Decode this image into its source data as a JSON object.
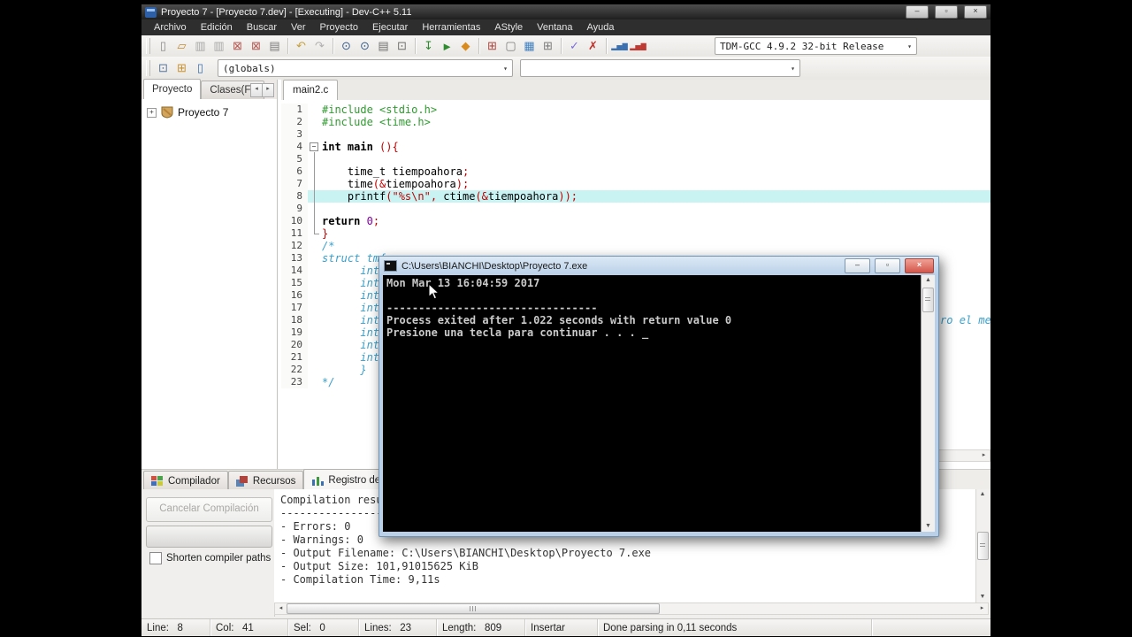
{
  "window": {
    "title": "Proyecto 7 - [Proyecto 7.dev] - [Executing] - Dev-C++ 5.11",
    "buttons": {
      "minimize": "–",
      "restore": "▫",
      "close": "×"
    }
  },
  "menus": [
    "Archivo",
    "Edición",
    "Buscar",
    "Ver",
    "Proyecto",
    "Ejecutar",
    "Herramientas",
    "AStyle",
    "Ventana",
    "Ayuda"
  ],
  "toolbar": {
    "compiler_value": "TDM-GCC 4.9.2 32-bit Release",
    "globals_value": "(globals)",
    "row1": [
      {
        "name": "new-source-icon",
        "g": "▯",
        "c": "#8a8a8a"
      },
      {
        "name": "open-file-icon",
        "g": "▱",
        "c": "#c08a2e"
      },
      {
        "name": "save-icon",
        "g": "▥",
        "c": "#a8a8a8"
      },
      {
        "name": "save-all-icon",
        "g": "▥",
        "c": "#a8a8a8"
      },
      {
        "name": "close-file-icon",
        "g": "⊠",
        "c": "#b5564e"
      },
      {
        "name": "close-all-icon",
        "g": "⊠",
        "c": "#b5564e"
      },
      {
        "name": "print-icon",
        "g": "▤",
        "c": "#7a7a7a"
      },
      {
        "sep": true
      },
      {
        "name": "undo-icon",
        "g": "↶",
        "c": "#c5a13f"
      },
      {
        "name": "redo-icon",
        "g": "↷",
        "c": "#b0b0b0"
      },
      {
        "sep": true
      },
      {
        "name": "find-icon",
        "g": "⊙",
        "c": "#3a5d8c"
      },
      {
        "name": "find-replace-icon",
        "g": "⊙",
        "c": "#3a5d8c"
      },
      {
        "name": "goto-line-icon",
        "g": "▤",
        "c": "#6f6f6f"
      },
      {
        "name": "swap-header-icon",
        "g": "⊡",
        "c": "#6f6f6f"
      },
      {
        "sep": true
      },
      {
        "name": "compile-icon",
        "g": "↧",
        "c": "#2e8b2e"
      },
      {
        "name": "run-icon",
        "g": "►",
        "c": "#2e8b2e"
      },
      {
        "name": "compile-run-icon",
        "g": "◆",
        "c": "#d98b1e"
      },
      {
        "sep": true
      },
      {
        "name": "rebuild-icon",
        "g": "⊞",
        "c": "#b0443c"
      },
      {
        "name": "new-window-icon",
        "g": "▢",
        "c": "#7a7a7a"
      },
      {
        "name": "project-options-icon",
        "g": "▦",
        "c": "#3f7fbf"
      },
      {
        "name": "window-grid-icon",
        "g": "⊞",
        "c": "#7a7a7a"
      },
      {
        "sep": true
      },
      {
        "name": "debug-icon",
        "g": "✓",
        "c": "#7d6fd8"
      },
      {
        "name": "abort-icon",
        "g": "✗",
        "c": "#c0302a"
      },
      {
        "sep": true
      },
      {
        "name": "profile-icon",
        "g": "▂▅▇",
        "c": "#3a6fb0",
        "fs": 8
      },
      {
        "name": "delete-profile-icon",
        "g": "▂▅▇",
        "c": "#bf3a32",
        "fs": 8
      }
    ],
    "row2": [
      {
        "name": "nav-back-icon",
        "g": "⊡",
        "c": "#56749a"
      },
      {
        "name": "add-watch-icon",
        "g": "⊞",
        "c": "#c8912e"
      },
      {
        "name": "view-file-icon",
        "g": "▯",
        "c": "#3a6fb0"
      }
    ]
  },
  "left_panel": {
    "tabs": [
      {
        "label": "Proyecto",
        "active": true
      },
      {
        "label": "Clases(Fun",
        "active": false
      }
    ],
    "project_name": "Proyecto 7"
  },
  "editor": {
    "tab": "main2.c",
    "lines": [
      {
        "n": 1,
        "segs": [
          {
            "t": "#include <stdio.h>",
            "c": "pp"
          }
        ]
      },
      {
        "n": 2,
        "segs": [
          {
            "t": "#include <time.h>",
            "c": "pp"
          }
        ]
      },
      {
        "n": 3,
        "segs": []
      },
      {
        "n": 4,
        "fold": "start",
        "segs": [
          {
            "t": "int main ",
            "c": "kw"
          },
          {
            "t": "(){",
            "c": "sym"
          }
        ]
      },
      {
        "n": 5,
        "fold": "mid",
        "segs": []
      },
      {
        "n": 6,
        "fold": "mid",
        "segs": [
          {
            "t": "    time_t tiempoahora",
            "c": "txt"
          },
          {
            "t": ";",
            "c": "sym"
          }
        ]
      },
      {
        "n": 7,
        "fold": "mid",
        "segs": [
          {
            "t": "    time",
            "c": "txt"
          },
          {
            "t": "(&",
            "c": "sym"
          },
          {
            "t": "tiempoahora",
            "c": "txt"
          },
          {
            "t": ");",
            "c": "sym"
          }
        ]
      },
      {
        "n": 8,
        "hl": true,
        "fold": "mid",
        "segs": [
          {
            "t": "    printf",
            "c": "txt"
          },
          {
            "t": "(\"",
            "c": "sym"
          },
          {
            "t": "%s\\n",
            "c": "str"
          },
          {
            "t": "\", ",
            "c": "sym"
          },
          {
            "t": "ctime",
            "c": "txt"
          },
          {
            "t": "(&",
            "c": "sym"
          },
          {
            "t": "tiempoahora",
            "c": "txt"
          },
          {
            "t": "));",
            "c": "sym"
          }
        ]
      },
      {
        "n": 9,
        "fold": "mid",
        "segs": []
      },
      {
        "n": 10,
        "fold": "mid",
        "segs": [
          {
            "t": "return ",
            "c": "kw"
          },
          {
            "t": "0",
            "c": "num"
          },
          {
            "t": ";",
            "c": "sym"
          }
        ]
      },
      {
        "n": 11,
        "fold": "end",
        "segs": [
          {
            "t": "}",
            "c": "sym"
          }
        ]
      },
      {
        "n": 12,
        "segs": [
          {
            "t": "/*",
            "c": "cmt"
          }
        ]
      },
      {
        "n": 13,
        "segs": [
          {
            "t": "struct tm{",
            "c": "cmt"
          }
        ]
      },
      {
        "n": 14,
        "segs": [
          {
            "t": "      int",
            "c": "cmt"
          }
        ]
      },
      {
        "n": 15,
        "segs": [
          {
            "t": "      int",
            "c": "cmt"
          }
        ]
      },
      {
        "n": 16,
        "segs": [
          {
            "t": "      int",
            "c": "cmt"
          }
        ]
      },
      {
        "n": 17,
        "segs": [
          {
            "t": "      int",
            "c": "cmt"
          }
        ]
      },
      {
        "n": 18,
        "segs": [
          {
            "t": "      int",
            "c": "cmt"
          },
          {
            "t": "ro el mes",
            "c": "cmt",
            "ml": 634
          }
        ]
      },
      {
        "n": 19,
        "segs": [
          {
            "t": "      int",
            "c": "cmt"
          }
        ]
      },
      {
        "n": 20,
        "segs": [
          {
            "t": "      int",
            "c": "cmt"
          }
        ]
      },
      {
        "n": 21,
        "segs": [
          {
            "t": "      int",
            "c": "cmt"
          }
        ]
      },
      {
        "n": 22,
        "segs": [
          {
            "t": "      }",
            "c": "cmt"
          }
        ]
      },
      {
        "n": 23,
        "segs": [
          {
            "t": "*/",
            "c": "cmt"
          }
        ]
      }
    ]
  },
  "console": {
    "title": "C:\\Users\\BIANCHI\\Desktop\\Proyecto 7.exe",
    "buttons": {
      "minimize": "–",
      "restore": "▫",
      "close": "×"
    },
    "lines": [
      "Mon Mar 13 16:04:59 2017",
      "",
      "---------------------------------",
      "Process exited after 1.022 seconds with return value 0",
      "Presione una tecla para continuar . . . _"
    ]
  },
  "bottom": {
    "tabs": [
      {
        "label": "Compilador",
        "icon": "compiler-grid-icon",
        "active": false
      },
      {
        "label": "Recursos",
        "icon": "resources-icon",
        "active": false
      },
      {
        "label": "Registro de Co",
        "icon": "log-chart-icon",
        "active": true
      }
    ],
    "cancel_button": "Cancelar Compilación",
    "shorten_label": "Shorten compiler paths",
    "log_lines": [
      "Compilation results...",
      "------------------------------",
      "- Errors: 0",
      "- Warnings: 0",
      "- Output Filename: C:\\Users\\BIANCHI\\Desktop\\Proyecto 7.exe",
      "- Output Size: 101,91015625 KiB",
      "- Compilation Time: 9,11s"
    ]
  },
  "status": {
    "segments": [
      "Line:   8",
      "Col:   41",
      "Sel:   0",
      "Lines:   23",
      "Length:   809",
      "Insertar",
      "Done parsing in 0,11 seconds"
    ]
  }
}
